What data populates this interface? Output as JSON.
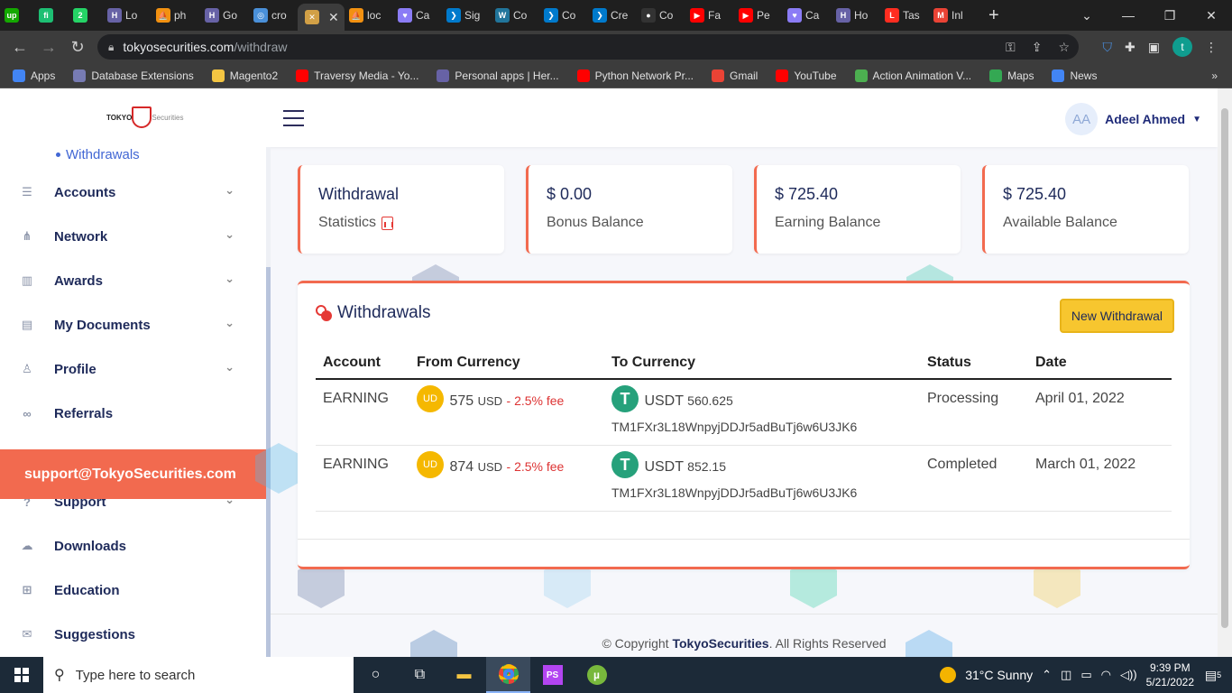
{
  "browser": {
    "tabs": [
      {
        "label": "",
        "icon": "upwork-icon",
        "color": "#14a800",
        "glyph": "up"
      },
      {
        "label": "",
        "icon": "fiverr-icon",
        "color": "#1dbf73",
        "glyph": "fi"
      },
      {
        "label": "",
        "icon": "whatsapp-icon",
        "color": "#25d366",
        "glyph": "2"
      },
      {
        "label": "Lo",
        "icon": "heroku-icon",
        "color": "#6762a6",
        "glyph": "H"
      },
      {
        "label": "ph",
        "icon": "pma-icon",
        "color": "#f29111",
        "glyph": "⛵"
      },
      {
        "label": "Go",
        "icon": "heroku-icon",
        "color": "#6762a6",
        "glyph": "H"
      },
      {
        "label": "cro",
        "icon": "globe-icon",
        "color": "#4a90d9",
        "glyph": "◎"
      },
      {
        "label": "",
        "icon": "x-tab-icon",
        "color": "#d2a046",
        "glyph": "✕",
        "active": true
      },
      {
        "label": "loc",
        "icon": "pma-icon",
        "color": "#f29111",
        "glyph": "⛵"
      },
      {
        "label": "Ca",
        "icon": "heart-icon",
        "color": "#8b7cf6",
        "glyph": "♥"
      },
      {
        "label": "Sig",
        "icon": "vscode-icon",
        "color": "#007acc",
        "glyph": "❯"
      },
      {
        "label": "Co",
        "icon": "wordpress-icon",
        "color": "#21759b",
        "glyph": "W"
      },
      {
        "label": "Co",
        "icon": "vscode-icon",
        "color": "#007acc",
        "glyph": "❯"
      },
      {
        "label": "Cre",
        "icon": "vscode-icon",
        "color": "#007acc",
        "glyph": "❯"
      },
      {
        "label": "Co",
        "icon": "github-icon",
        "color": "#333333",
        "glyph": "●"
      },
      {
        "label": "Fa",
        "icon": "youtube-icon",
        "color": "#ff0000",
        "glyph": "▶"
      },
      {
        "label": "Pe",
        "icon": "youtube-icon",
        "color": "#ff0000",
        "glyph": "▶"
      },
      {
        "label": "Ca",
        "icon": "heart-icon",
        "color": "#8b7cf6",
        "glyph": "♥"
      },
      {
        "label": "Ho",
        "icon": "heroku-icon",
        "color": "#6762a6",
        "glyph": "H"
      },
      {
        "label": "Tas",
        "icon": "laravel-icon",
        "color": "#ff2d20",
        "glyph": "L"
      },
      {
        "label": "Inl",
        "icon": "gmail-icon",
        "color": "#ea4335",
        "glyph": "M"
      }
    ],
    "url_host": "tokyosecurities.com",
    "url_path": "/withdraw",
    "profile_initial": "t",
    "bookmarks": [
      {
        "label": "Apps",
        "icon": "apps-grid-icon",
        "color": "#4285f4"
      },
      {
        "label": "Database Extensions",
        "icon": "php-icon",
        "color": "#777bb3"
      },
      {
        "label": "Magento2",
        "icon": "folder-icon",
        "color": "#f4c542"
      },
      {
        "label": "Traversy Media - Yo...",
        "icon": "youtube-icon",
        "color": "#ff0000"
      },
      {
        "label": "Personal apps | Her...",
        "icon": "heroku-icon",
        "color": "#6762a6"
      },
      {
        "label": "Python Network Pr...",
        "icon": "youtube-icon",
        "color": "#ff0000"
      },
      {
        "label": "Gmail",
        "icon": "gmail-icon",
        "color": "#ea4335"
      },
      {
        "label": "YouTube",
        "icon": "youtube-icon",
        "color": "#ff0000"
      },
      {
        "label": "Action Animation V...",
        "icon": "ck-icon",
        "color": "#4caf50"
      },
      {
        "label": "Maps",
        "icon": "maps-pin-icon",
        "color": "#34a853"
      },
      {
        "label": "News",
        "icon": "news-icon",
        "color": "#4285f4"
      }
    ]
  },
  "header": {
    "logo_word": "TOKYO",
    "logo_sub": "Securities",
    "user_initials": "AA",
    "user_name": "Adeel Ahmed"
  },
  "sidebar": {
    "sub_item": "Withdrawals",
    "items": [
      {
        "label": "Accounts",
        "icon": "list-icon",
        "chevron": true
      },
      {
        "label": "Network",
        "icon": "network-icon",
        "chevron": true
      },
      {
        "label": "Awards",
        "icon": "bar-chart-icon",
        "chevron": true
      },
      {
        "label": "My Documents",
        "icon": "document-icon",
        "chevron": true
      },
      {
        "label": "Profile",
        "icon": "user-icon",
        "chevron": true
      },
      {
        "label": "Referrals",
        "icon": "link-icon",
        "chevron": false
      },
      {
        "label": "Support",
        "icon": "help-icon",
        "chevron": true
      },
      {
        "label": "Downloads",
        "icon": "cloud-download-icon",
        "chevron": false
      },
      {
        "label": "Education",
        "icon": "plus-square-icon",
        "chevron": false
      },
      {
        "label": "Suggestions",
        "icon": "mail-icon",
        "chevron": false
      }
    ],
    "support_email": "support@TokyoSecurities.com"
  },
  "stats": [
    {
      "big": "Withdrawal",
      "sub": "Statistics"
    },
    {
      "big": "$ 0.00",
      "sub": "Bonus Balance"
    },
    {
      "big": "$ 725.40",
      "sub": "Earning Balance"
    },
    {
      "big": "$ 725.40",
      "sub": "Available Balance"
    }
  ],
  "withdrawals": {
    "title": "Withdrawals",
    "new_button": "New Withdrawal",
    "columns": [
      "Account",
      "From Currency",
      "To Currency",
      "Status",
      "Date"
    ],
    "rows": [
      {
        "account": "EARNING",
        "from_badge": "UD",
        "from_amount": "575",
        "from_unit": "USD",
        "fee": "- 2.5% fee",
        "to_code": "USDT",
        "to_amount": "560.625",
        "address": "TM1FXr3L18WnpyjDDJr5adBuTj6w6U3JK6",
        "status": "Processing",
        "date": "April 01, 2022"
      },
      {
        "account": "EARNING",
        "from_badge": "UD",
        "from_amount": "874",
        "from_unit": "USD",
        "fee": "- 2.5% fee",
        "to_code": "USDT",
        "to_amount": "852.15",
        "address": "TM1FXr3L18WnpyjDDJr5adBuTj6w6U3JK6",
        "status": "Completed",
        "date": "March 01, 2022"
      }
    ]
  },
  "footer": {
    "prefix": "© Copyright",
    "brand": "TokyoSecurities",
    "suffix": ". All Rights Reserved"
  },
  "taskbar": {
    "search_placeholder": "Type here to search",
    "weather": "31°C  Sunny",
    "time": "9:39 PM",
    "date": "5/21/2022",
    "notifications": "5"
  }
}
